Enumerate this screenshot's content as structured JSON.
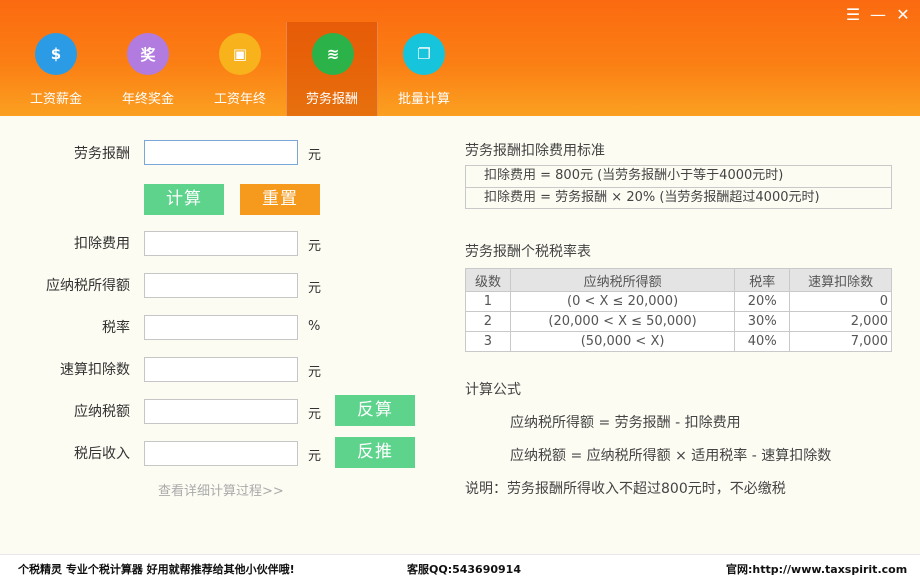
{
  "window": {
    "min_icon": "minimize-icon",
    "menu_icon": "menu-icon",
    "close_icon": "close-icon"
  },
  "tabs": [
    {
      "label": "工资薪金",
      "icon": "money-bag-icon",
      "glyph": "$",
      "color": "#2b9be5",
      "active": false
    },
    {
      "label": "年终奖金",
      "icon": "bonus-icon",
      "glyph": "奖",
      "color": "#b27be0",
      "active": false
    },
    {
      "label": "工资年终",
      "icon": "wallet-icon",
      "glyph": "▣",
      "color": "#f7b21c",
      "active": false
    },
    {
      "label": "劳务报酬",
      "icon": "coins-icon",
      "glyph": "≋",
      "color": "#2bb34a",
      "active": true
    },
    {
      "label": "批量计算",
      "icon": "batch-icon",
      "glyph": "❐",
      "color": "#16c5dc",
      "active": false
    }
  ],
  "form": {
    "income_label": "劳务报酬",
    "income_value": "",
    "unit_yuan": "元",
    "unit_percent": "%",
    "calc_button": "计算",
    "reset_button": "重置",
    "deduction_label": "扣除费用",
    "taxable_label": "应纳税所得额",
    "rate_label": "税率",
    "quick_deduction_label": "速算扣除数",
    "tax_label": "应纳税额",
    "after_tax_label": "税后收入",
    "reverse_calc_button": "反算",
    "reverse_push_button": "反推",
    "detail_link": "查看详细计算过程>>"
  },
  "info": {
    "standard_title": "劳务报酬扣除费用标准",
    "standard_rows": [
      "扣除费用 = 800元 (当劳务报酬小于等于4000元时)",
      "扣除费用 = 劳务报酬 × 20% (当劳务报酬超过4000元时)"
    ],
    "rate_table_title": "劳务报酬个税税率表",
    "rate_table_headers": [
      "级数",
      "应纳税所得额",
      "税率",
      "速算扣除数"
    ],
    "rate_table_rows": [
      [
        "1",
        "(0 < X ≤ 20,000)",
        "20%",
        "0"
      ],
      [
        "2",
        "(20,000 < X ≤ 50,000)",
        "30%",
        "2,000"
      ],
      [
        "3",
        "(50,000 < X)",
        "40%",
        "7,000"
      ]
    ],
    "formula_title": "计算公式",
    "formula_1": "应纳税所得额 = 劳务报酬 - 扣除费用",
    "formula_2": "应纳税额 = 应纳税所得额 × 适用税率 - 速算扣除数",
    "note": "说明：劳务报酬所得收入不超过800元时，不必缴税"
  },
  "footer": {
    "slogan": "个税精灵 专业个税计算器 好用就帮推荐给其他小伙伴哦!",
    "qq": "客服QQ:543690914",
    "website": "官网:http://www.taxspirit.com"
  }
}
